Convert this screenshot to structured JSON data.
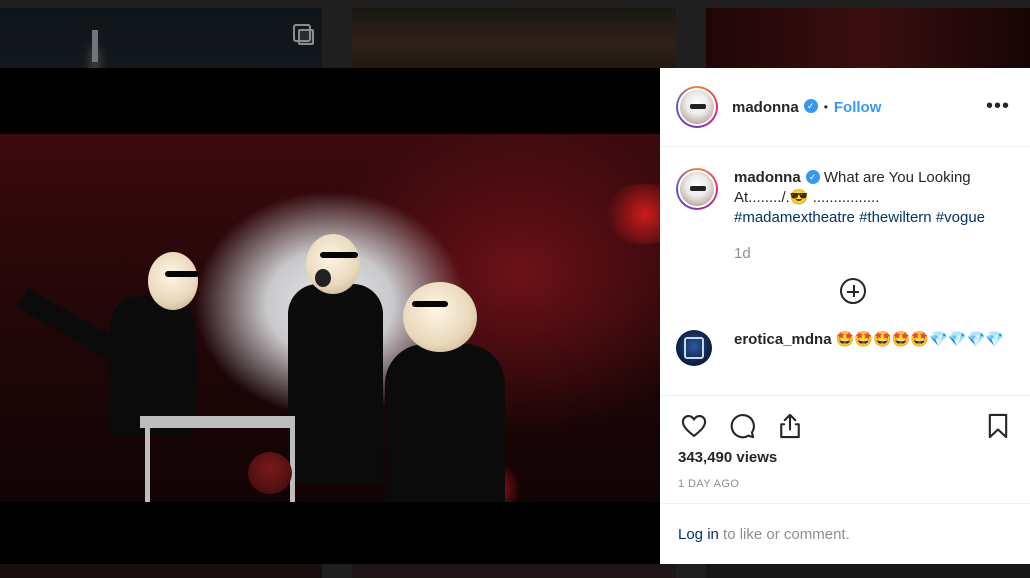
{
  "post": {
    "username": "madonna",
    "verified_icon": "verified-badge-icon",
    "separator": "•",
    "follow_label": "Follow",
    "more_label": "•••",
    "caption_text": "What are You Looking At......../.",
    "caption_emoji": "😎",
    "caption_tail": " ................",
    "hashtags": [
      "#madamextheatre",
      "#thewiltern",
      "#vogue"
    ],
    "age": "1d",
    "views": "343,490 views",
    "date": "1 DAY AGO",
    "login_link": "Log in",
    "login_rest": " to like or comment."
  },
  "comment": {
    "username": "erotica_mdna",
    "text": "🤩🤩🤩🤩🤩💎💎💎💎"
  },
  "colors": {
    "accent": "#3897f0",
    "link": "#003569",
    "muted": "#8e8e8e",
    "text": "#262626"
  }
}
